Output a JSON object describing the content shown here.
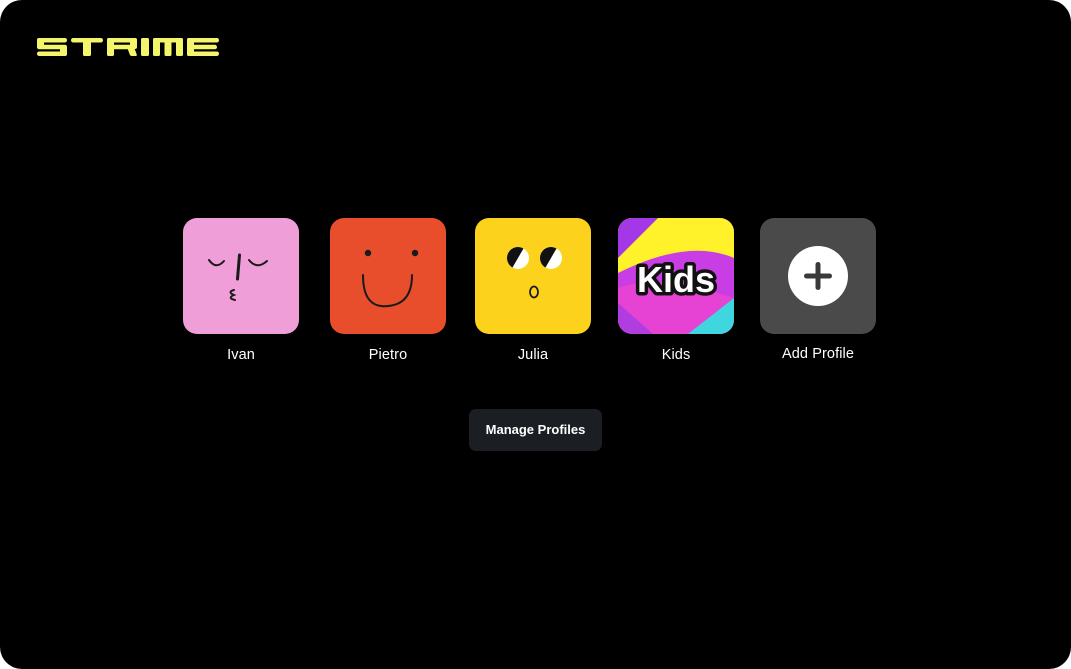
{
  "app": {
    "brand": "STRIME",
    "brand_color": "#f4f56a",
    "background": "#000000"
  },
  "profiles": [
    {
      "name": "Ivan",
      "avatar": "kissing-face-icon",
      "color": "#f09ed7"
    },
    {
      "name": "Pietro",
      "avatar": "smiling-face-icon",
      "color": "#e94e2c"
    },
    {
      "name": "Julia",
      "avatar": "surprised-face-icon",
      "color": "#fcd21c"
    },
    {
      "name": "Kids",
      "avatar": "kids-icon",
      "color": "#c93ee4"
    },
    {
      "name": "Add Profile",
      "avatar": "plus-icon",
      "color": "#4a4a4a"
    }
  ],
  "manage": {
    "label": "Manage Profiles",
    "background": "#1b1f23"
  }
}
